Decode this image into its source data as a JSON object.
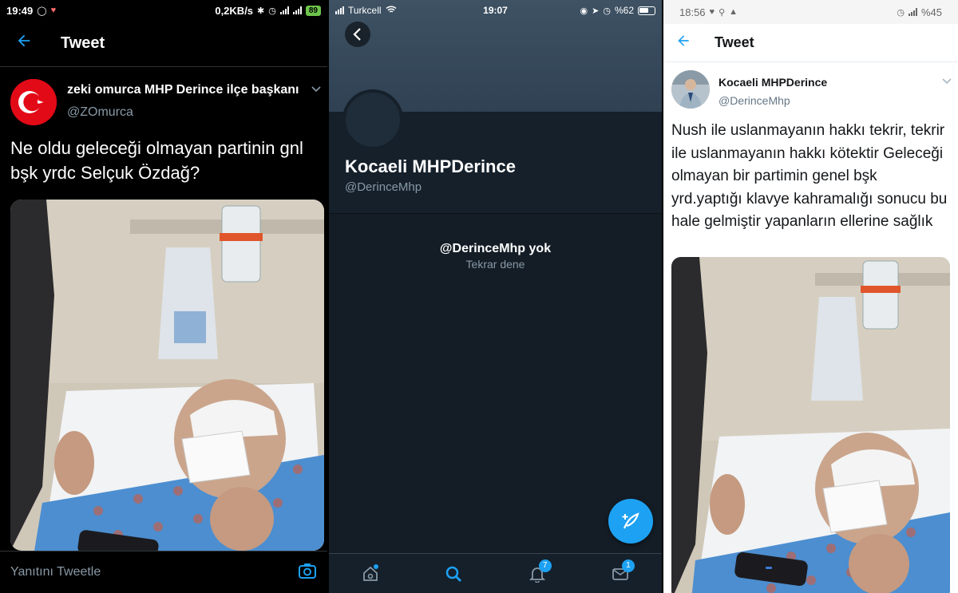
{
  "left_panel": {
    "status": {
      "time": "19:49",
      "speed": "0,2KB/s",
      "battery": "89"
    },
    "topbar": {
      "title": "Tweet"
    },
    "tweet": {
      "name": "zeki omurca MHP Derince ilçe başkanı",
      "handle": "@ZOmurca",
      "text": "Ne oldu geleceği olmayan partinin gnl bşk yrdc Selçuk Özdağ?"
    },
    "reply": {
      "placeholder": "Yanıtını Tweetle"
    }
  },
  "middle_panel": {
    "status": {
      "carrier": "Turkcell",
      "time": "19:07",
      "battery": "%62"
    },
    "profile": {
      "name": "Kocaeli MHPDerince",
      "handle": "@DerinceMhp",
      "error_title": "@DerinceMhp yok",
      "error_action": "Tekrar dene"
    },
    "tabs": {
      "notifications_badge": "7",
      "messages_badge": "1"
    }
  },
  "right_panel": {
    "status": {
      "time": "18:56",
      "battery": "%45"
    },
    "topbar": {
      "title": "Tweet"
    },
    "tweet": {
      "name": "Kocaeli MHPDerince",
      "handle": "@DerinceMhp",
      "text": "Nush ile uslanmayanın hakkı tekrir, tekrir ile uslanmayanın hakkı kötektir Geleceği olmayan bir partimin genel bşk yrd.yaptığı klavye kahramalığı sonucu bu hale gelmiştir yapanların ellerine sağlık"
    }
  },
  "colors": {
    "twitter_blue": "#1da1f2",
    "dark_bg": "#15202b",
    "turkish_red": "#e30a17"
  }
}
